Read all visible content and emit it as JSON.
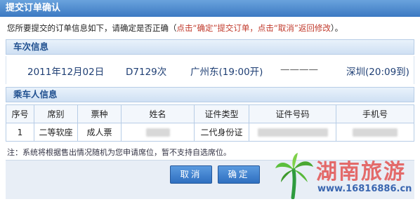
{
  "window": {
    "title": "提交订单确认"
  },
  "intro": {
    "text": "您所要提交的订单信息如下，请确定是否正确（",
    "hint": "点击“确定”提交订单，点击“取消”返回修改",
    "end": "）。"
  },
  "train_section": {
    "title": "车次信息"
  },
  "train": {
    "date": "2011年12月02日",
    "number": "D7129次",
    "from": "广州东(19:00开)",
    "separator": "————",
    "to": "深圳(20:09到)"
  },
  "passenger_section": {
    "title": "乘车人信息"
  },
  "table": {
    "headers": [
      "序号",
      "席别",
      "票种",
      "姓名",
      "证件类型",
      "证件号码",
      "手机号"
    ],
    "rows": [
      {
        "index": "1",
        "seat": "二等软座",
        "ticket": "成人票",
        "id_type": "二代身份证"
      }
    ]
  },
  "note": "注：系统将根据售出情况随机为您申请席位，暂不支持自选席位。",
  "buttons": {
    "cancel": "取消",
    "confirm": "确定"
  },
  "watermark": {
    "text": "湖南旅游",
    "url": "www.16816886.cn"
  }
}
